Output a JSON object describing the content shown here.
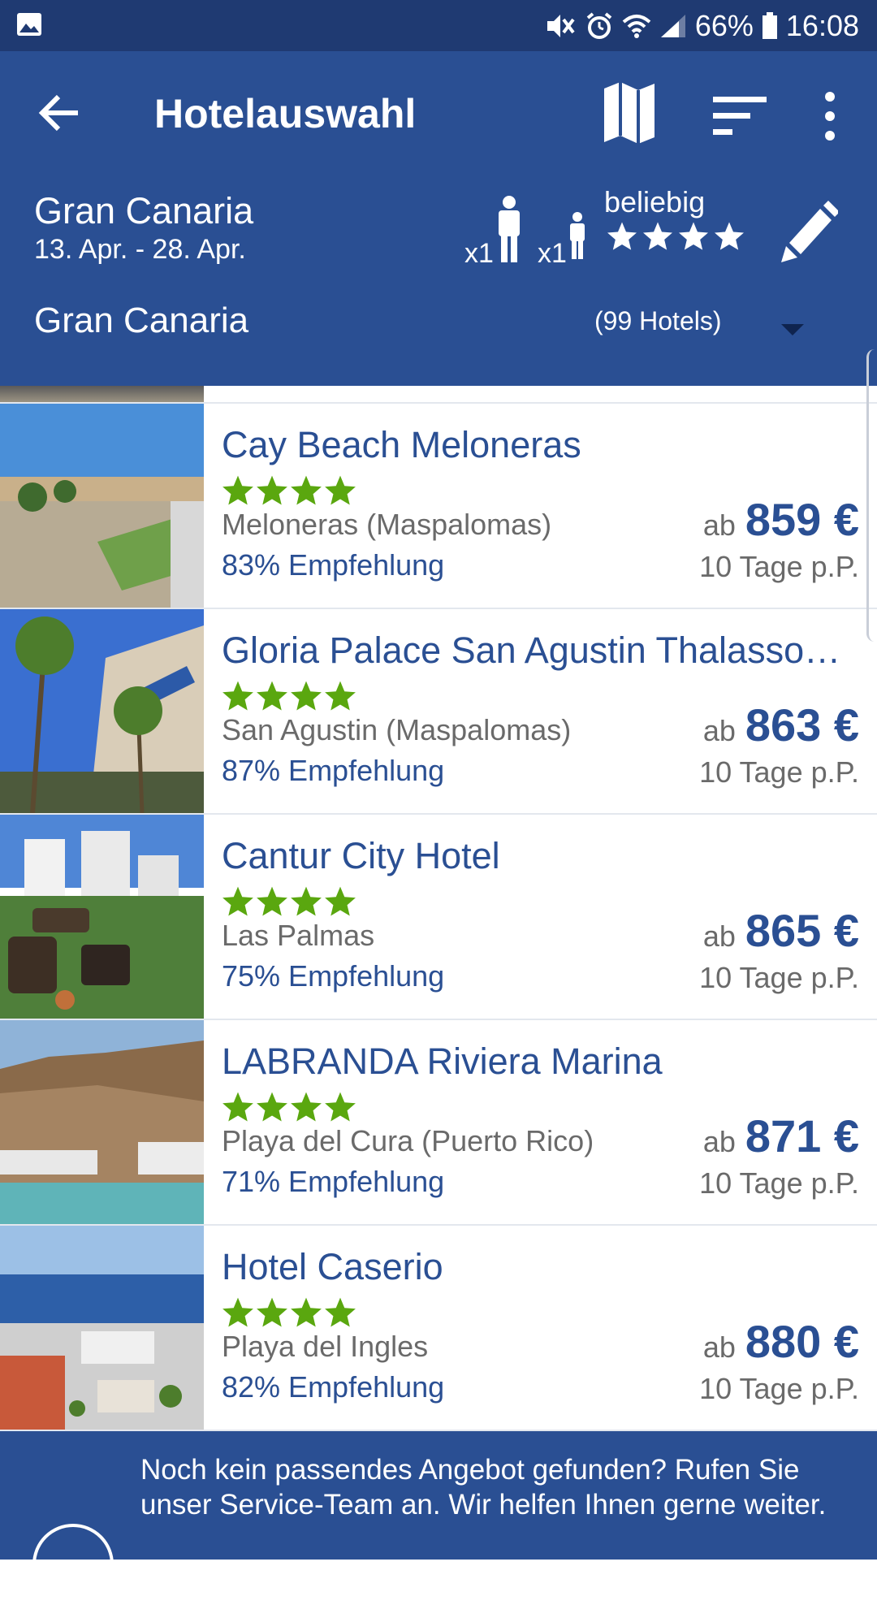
{
  "status_bar": {
    "battery": "66%",
    "time": "16:08"
  },
  "app_bar": {
    "title": "Hotelauswahl"
  },
  "search": {
    "destination": "Gran Canaria",
    "dates": "13. Apr. - 28. Apr.",
    "adults_label": "x1",
    "children_label": "x1",
    "rating_label": "beliebig",
    "rating_stars": 4
  },
  "filter": {
    "region": "Gran Canaria",
    "count": "(99 Hotels)"
  },
  "hotels": [
    {
      "name": "Cay Beach Meloneras",
      "stars": 4,
      "location": "Meloneras (Maspalomas)",
      "recommendation": "83% Empfehlung",
      "price_prefix": "ab",
      "price": "859 €",
      "duration": "10 Tage p.P."
    },
    {
      "name": "Gloria Palace San Agustin Thalasso…",
      "stars": 4,
      "location": "San Agustin (Maspalomas)",
      "recommendation": "87% Empfehlung",
      "price_prefix": "ab",
      "price": "863 €",
      "duration": "10 Tage p.P."
    },
    {
      "name": "Cantur City Hotel",
      "stars": 4,
      "location": "Las Palmas",
      "recommendation": "75% Empfehlung",
      "price_prefix": "ab",
      "price": "865 €",
      "duration": "10 Tage p.P."
    },
    {
      "name": "LABRANDA Riviera Marina",
      "stars": 4,
      "location": "Playa del Cura (Puerto Rico)",
      "recommendation": "71% Empfehlung",
      "price_prefix": "ab",
      "price": "871 €",
      "duration": "10 Tage p.P."
    },
    {
      "name": "Hotel Caserio",
      "stars": 4,
      "location": "Playa del Ingles",
      "recommendation": "82% Empfehlung",
      "price_prefix": "ab",
      "price": "880 €",
      "duration": "10 Tage p.P."
    }
  ],
  "service_banner": {
    "message": "Noch kein passendes Angebot gefunden? Rufen Sie unser Service-Team an. Wir helfen Ihnen gerne weiter."
  },
  "colors": {
    "status_bar": "#1f3a72",
    "primary": "#2a4f93",
    "star_green": "#5aa70f",
    "text_gray": "#6a6a6a"
  }
}
